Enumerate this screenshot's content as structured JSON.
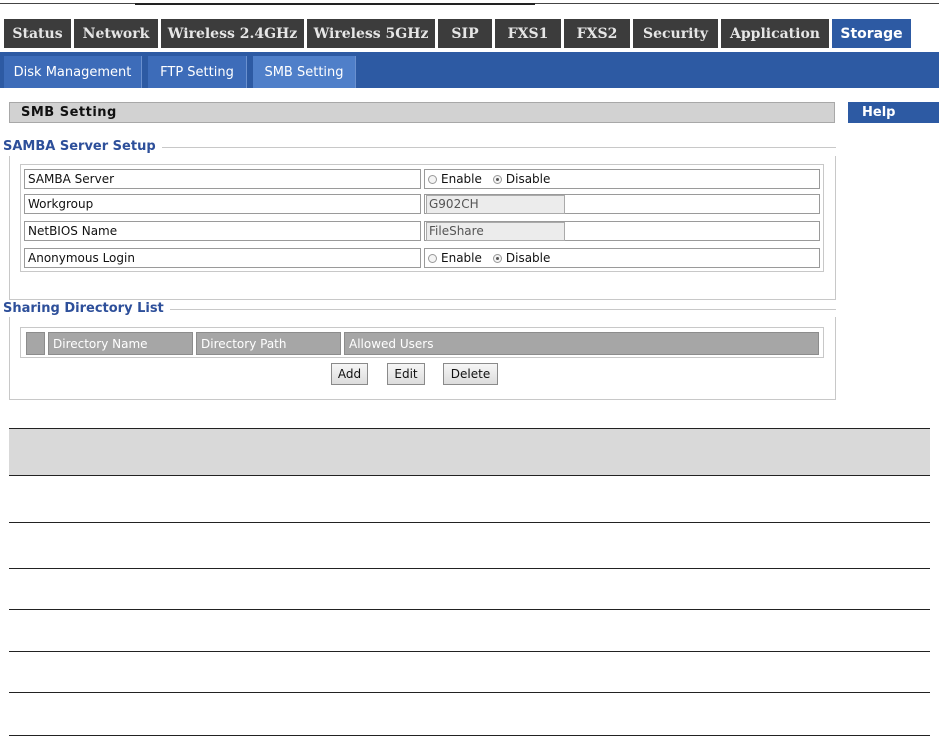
{
  "nav": {
    "tabs": [
      {
        "label": "Status",
        "width": 67
      },
      {
        "label": "Network",
        "width": 84
      },
      {
        "label": "Wireless 2.4GHz",
        "width": 143
      },
      {
        "label": "Wireless 5GHz",
        "width": 128
      },
      {
        "label": "SIP",
        "width": 54
      },
      {
        "label": "FXS1",
        "width": 66
      },
      {
        "label": "FXS2",
        "width": 66
      },
      {
        "label": "Security",
        "width": 85
      },
      {
        "label": "Application",
        "width": 108
      },
      {
        "label": "Storage",
        "width": 83
      }
    ],
    "active": "Storage"
  },
  "subnav": {
    "tabs": [
      "Disk Management",
      "FTP Setting",
      "SMB Setting"
    ],
    "active": "SMB Setting"
  },
  "section": {
    "title": "SMB Setting",
    "help": "Help"
  },
  "samba": {
    "legend": "SAMBA Server Setup",
    "server_label": "SAMBA Server",
    "workgroup_label": "Workgroup",
    "workgroup_value": "G902CH",
    "netbios_label": "NetBIOS Name",
    "netbios_value": "FileShare",
    "anon_label": "Anonymous Login",
    "enable": "Enable",
    "disable": "Disable"
  },
  "sharing": {
    "legend": "Sharing Directory List",
    "columns": [
      "Directory Name",
      "Directory Path",
      "Allowed Users"
    ],
    "buttons": {
      "add": "Add",
      "edit": "Edit",
      "delete": "Delete"
    }
  }
}
